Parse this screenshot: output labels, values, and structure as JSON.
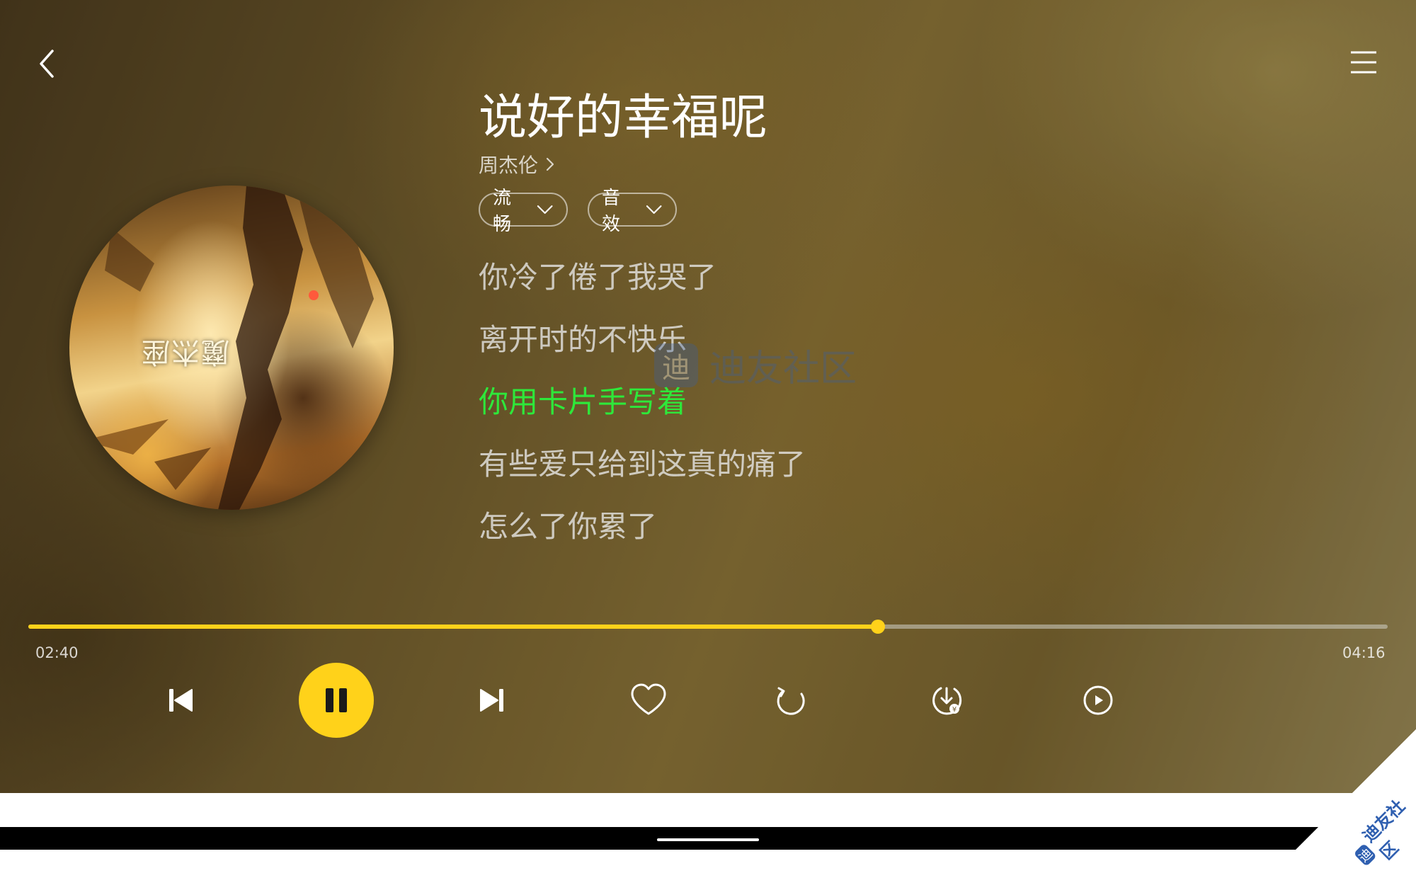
{
  "header": {
    "back_icon": "back-chevron-icon",
    "menu_icon": "hamburger-menu-icon"
  },
  "song": {
    "title": "说好的幸福呢",
    "artist": "周杰伦",
    "album_art_text": "魔杰座"
  },
  "options": {
    "quality_label": "流畅",
    "effect_label": "音效"
  },
  "lyrics": {
    "lines": [
      "你冷了倦了我哭了",
      "离开时的不快乐",
      "你用卡片手写着",
      "有些爱只给到这真的痛了",
      "怎么了你累了"
    ],
    "current_index": 2,
    "current_color": "#2ee83a"
  },
  "watermark": {
    "logo_char": "迪",
    "text": "迪友社区"
  },
  "playback": {
    "elapsed": "02:40",
    "total": "04:16",
    "progress_fraction": 0.625,
    "accent_color": "#ffd21a"
  },
  "controls": {
    "icons": [
      "previous-icon",
      "pause-icon",
      "next-icon",
      "heart-icon",
      "repeat-icon",
      "download-icon",
      "video-icon"
    ]
  },
  "corner_badge": {
    "logo_char": "迪",
    "text": "迪友社区",
    "color": "#2f5fb0"
  }
}
